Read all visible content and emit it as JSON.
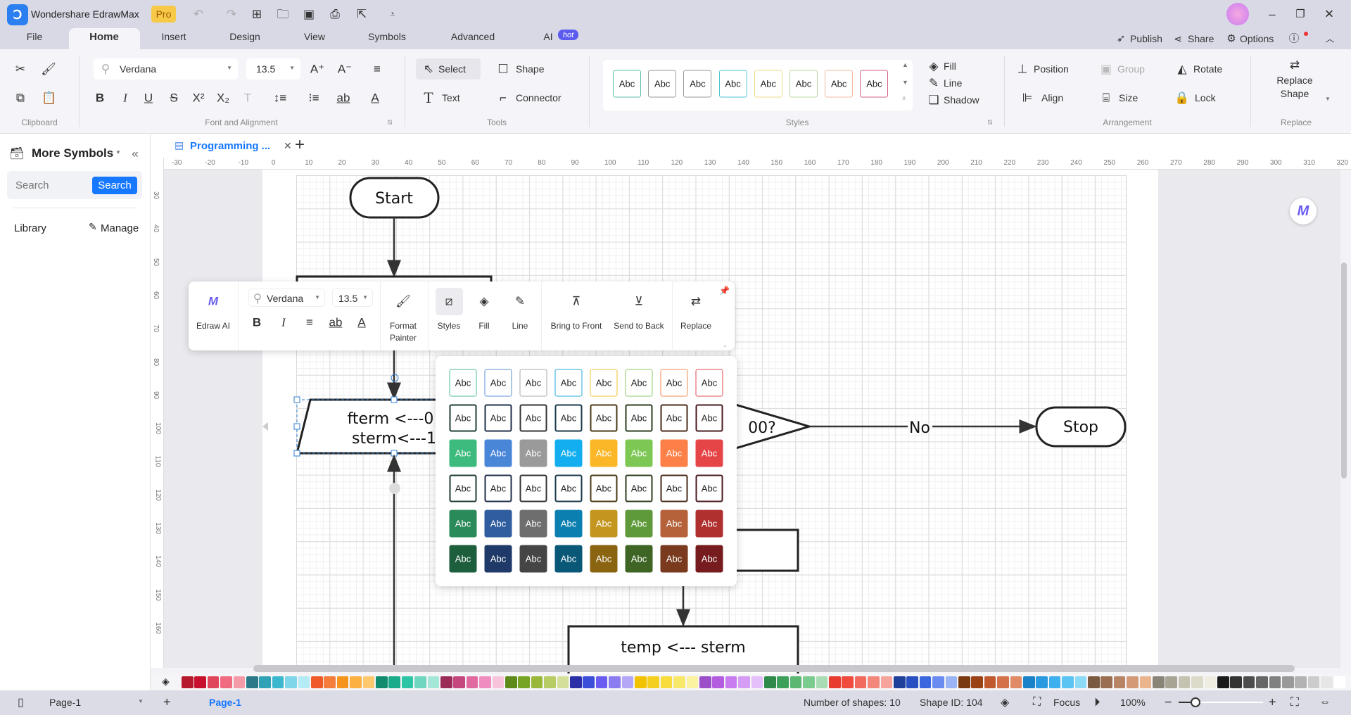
{
  "app": {
    "title": "Wondershare EdrawMax",
    "badge": "Pro"
  },
  "quick_access": [
    "undo-icon",
    "redo-icon",
    "new-icon",
    "open-icon",
    "save-icon",
    "print-icon",
    "export-icon",
    "more-icon"
  ],
  "menu_tabs": [
    {
      "label": "File"
    },
    {
      "label": "Home",
      "active": true
    },
    {
      "label": "Insert"
    },
    {
      "label": "Design"
    },
    {
      "label": "View"
    },
    {
      "label": "Symbols"
    },
    {
      "label": "Advanced"
    },
    {
      "label": "AI",
      "badge": "hot"
    }
  ],
  "title_actions": {
    "publish": "Publish",
    "share": "Share",
    "options": "Options"
  },
  "ribbon": {
    "font": {
      "family": "Verdana",
      "size": "13.5"
    },
    "tools": {
      "select": "Select",
      "shape": "Shape",
      "text": "Text",
      "connector": "Connector"
    },
    "styles_gallery": {
      "label": "Abc",
      "borders": [
        "#5fbfa9",
        "#9a9a9a",
        "#9a9a9a",
        "#4cc4d8",
        "#ecdc8a",
        "#b8d8a0",
        "#f0b8a0",
        "#d06080"
      ]
    },
    "style_opts": {
      "fill": "Fill",
      "line": "Line",
      "shadow": "Shadow"
    },
    "arrangement": {
      "position": "Position",
      "group": "Group",
      "rotate": "Rotate",
      "align": "Align",
      "size": "Size",
      "lock": "Lock"
    },
    "replace": {
      "line1": "Replace",
      "line2": "Shape"
    },
    "groups": {
      "clipboard": "Clipboard",
      "font": "Font and Alignment",
      "tools": "Tools",
      "styles": "Styles",
      "arrangement": "Arrangement",
      "replace": "Replace"
    }
  },
  "left_panel": {
    "title": "More Symbols",
    "search_placeholder": "Search",
    "search_button": "Search",
    "library": "Library",
    "manage": "Manage"
  },
  "doc_tab": {
    "title": "Programming ..."
  },
  "rulers": {
    "h": [
      -30,
      -20,
      -10,
      0,
      10,
      20,
      30,
      40,
      50,
      60,
      70,
      80,
      90,
      100,
      110,
      120,
      130,
      140,
      150,
      160,
      170,
      180,
      190,
      200,
      210,
      220,
      230,
      240,
      250,
      260,
      270,
      280,
      290,
      300,
      310,
      320
    ],
    "v": [
      30,
      40,
      50,
      60,
      70,
      80,
      90,
      100,
      110,
      120,
      130,
      140,
      150,
      160
    ]
  },
  "diagram": {
    "start": "Start",
    "stop": "Stop",
    "process1_line1": "fterm <---0",
    "process1_line2": "sterm<---1",
    "decision_partial": "00?",
    "no_label": "No",
    "process_last": "temp <--- sterm"
  },
  "float_toolbar": {
    "edraw_ai": "Edraw AI",
    "font": "Verdana",
    "size": "13.5",
    "format_painter_1": "Format",
    "format_painter_2": "Painter",
    "styles": "Styles",
    "fill": "Fill",
    "line": "Line",
    "bring_front": "Bring to Front",
    "send_back": "Send to Back",
    "replace": "Replace"
  },
  "style_popup": {
    "label": "Abc",
    "rows": [
      {
        "kind": "outline",
        "colors": [
          "#4cb89a",
          "#5b8fd6",
          "#a8a8a8",
          "#22a8d8",
          "#f0c030",
          "#8cc860",
          "#f08a50",
          "#e04a50"
        ]
      },
      {
        "kind": "dark-outline",
        "colors": [
          "#1f3d33",
          "#1f2f4a",
          "#333333",
          "#1a3a4a",
          "#4a3a14",
          "#2c3e1e",
          "#4a2a1a",
          "#4a1a1e"
        ]
      },
      {
        "kind": "fill",
        "colors": [
          "#3dbb7e",
          "#4a86d8",
          "#9a9a9a",
          "#12aef0",
          "#fbb728",
          "#7dc855",
          "#fd8048",
          "#e64548"
        ]
      },
      {
        "kind": "dark-outline",
        "colors": [
          "#1f3d33",
          "#1f2f4a",
          "#333333",
          "#1a3a4a",
          "#4a3a14",
          "#2c3e1e",
          "#4a2a1a",
          "#4a1a1e"
        ]
      },
      {
        "kind": "fill",
        "colors": [
          "#2a8a5a",
          "#2f5d9e",
          "#6e6e6e",
          "#0a7fb0",
          "#c5961f",
          "#5e9a3a",
          "#b5613a",
          "#b03030"
        ]
      },
      {
        "kind": "fill",
        "colors": [
          "#1d5e3c",
          "#1f3a68",
          "#454545",
          "#0a5878",
          "#8a6410",
          "#3e6524",
          "#7a3a1e",
          "#761c1e"
        ]
      }
    ]
  },
  "palette": [
    "#b5192b",
    "#c8102e",
    "#e0455b",
    "#f06a80",
    "#f59aa8",
    "#2a7a8a",
    "#2fa3b5",
    "#3bb7cf",
    "#7fd6e8",
    "#b5ebf5",
    "#f05a28",
    "#f57c3a",
    "#f7941d",
    "#fbb040",
    "#fdc86e",
    "#118c6e",
    "#1aab8a",
    "#2ec4a6",
    "#6fd6c0",
    "#a4e6d8",
    "#9b2c5a",
    "#c4487e",
    "#e06aa0",
    "#f08dc0",
    "#f7c4dc",
    "#5e8a1a",
    "#78a424",
    "#99b83a",
    "#b8cc64",
    "#d4e09a",
    "#2a2fa8",
    "#3b4fd8",
    "#6a5cf0",
    "#8c7cf2",
    "#b4a8f6",
    "#f2c200",
    "#f5cf1e",
    "#f7dc3c",
    "#f8e86a",
    "#fbf3a0",
    "#9b4fc8",
    "#b45ce0",
    "#c97cf0",
    "#d59cf4",
    "#e4c0f8",
    "#2e8b4a",
    "#3ca05a",
    "#5ab872",
    "#7ccb8e",
    "#a8ddb4",
    "#e83a2e",
    "#f04b3c",
    "#f26a5e",
    "#f4877c",
    "#f7a59c",
    "#1e3f9a",
    "#2850c0",
    "#3a66e0",
    "#6a8cf0",
    "#9ab4f5",
    "#7a3a10",
    "#9a4216",
    "#c05a2e",
    "#d4704a",
    "#e08a66",
    "#1a82c8",
    "#2a9ae0",
    "#3fb0ee",
    "#5cc4f2",
    "#8cdaf6",
    "#7a5a40",
    "#9a6e50",
    "#b88466",
    "#d49a78",
    "#eab48e",
    "#8a8478",
    "#a8a494",
    "#c4c2b0",
    "#dcdac8",
    "#efede2",
    "#1a1a1a",
    "#333333",
    "#4d4d4d",
    "#666666",
    "#808080",
    "#999999",
    "#b3b3b3",
    "#cccccc",
    "#e6e6e6",
    "#ffffff"
  ],
  "status": {
    "page_select": "Page-1",
    "page_tab": "Page-1",
    "shapes": "Number of shapes: 10",
    "shape_id": "Shape ID: 104",
    "focus": "Focus",
    "zoom": "100%",
    "zoom_level": 0.2
  },
  "colors": {
    "accent": "#1677ff",
    "selection": "#2f7fd1"
  }
}
